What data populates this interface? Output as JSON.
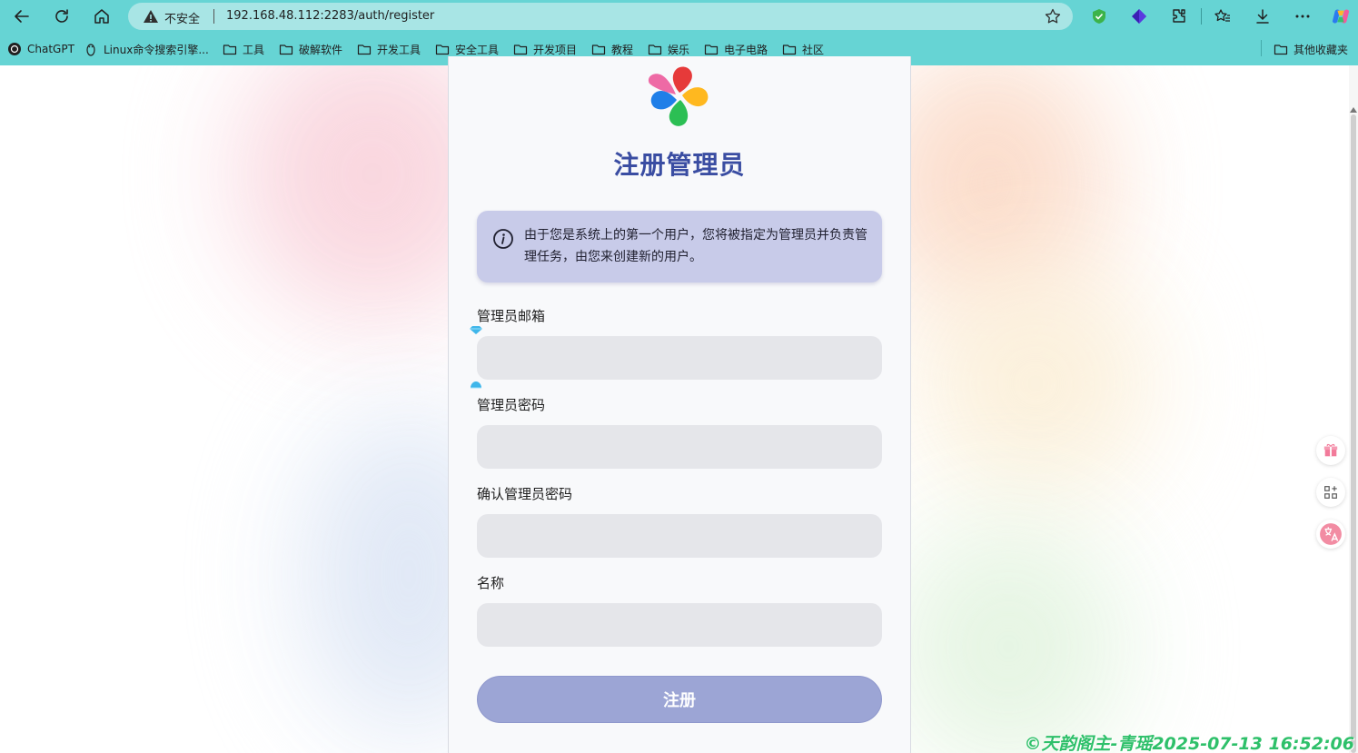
{
  "browser": {
    "security_label": "不安全",
    "url": "192.168.48.112:2283/auth/register"
  },
  "bookmarks": [
    {
      "label": "ChatGPT",
      "icon": "chatgpt-icon"
    },
    {
      "label": "Linux命令搜索引擎...",
      "icon": "linux-penguin-icon"
    },
    {
      "label": "工具",
      "icon": "folder-icon"
    },
    {
      "label": "破解软件",
      "icon": "folder-icon"
    },
    {
      "label": "开发工具",
      "icon": "folder-icon"
    },
    {
      "label": "安全工具",
      "icon": "folder-icon"
    },
    {
      "label": "开发项目",
      "icon": "folder-icon"
    },
    {
      "label": "教程",
      "icon": "folder-icon"
    },
    {
      "label": "娱乐",
      "icon": "folder-icon"
    },
    {
      "label": "电子电路",
      "icon": "folder-icon"
    },
    {
      "label": "社区",
      "icon": "folder-icon"
    }
  ],
  "other_bookmarks": "其他收藏夹",
  "page": {
    "title": "注册管理员",
    "notice": "由于您是系统上的第一个用户，您将被指定为管理员并负责管理任务，由您来创建新的用户。",
    "fields": {
      "email_label": "管理员邮箱",
      "email_value": "",
      "password_label": "管理员密码",
      "password_value": "",
      "confirm_label": "确认管理员密码",
      "confirm_value": "",
      "name_label": "名称",
      "name_value": ""
    },
    "submit_label": "注册"
  },
  "watermark": "©天韵阁主-青瑶2025-07-13 16:52:06",
  "colors": {
    "chrome": "#66d4d4",
    "title": "#3a4da2",
    "alert_bg": "#c8cbe9",
    "button": "#9ca5d5",
    "watermark": "#2ec06a"
  }
}
